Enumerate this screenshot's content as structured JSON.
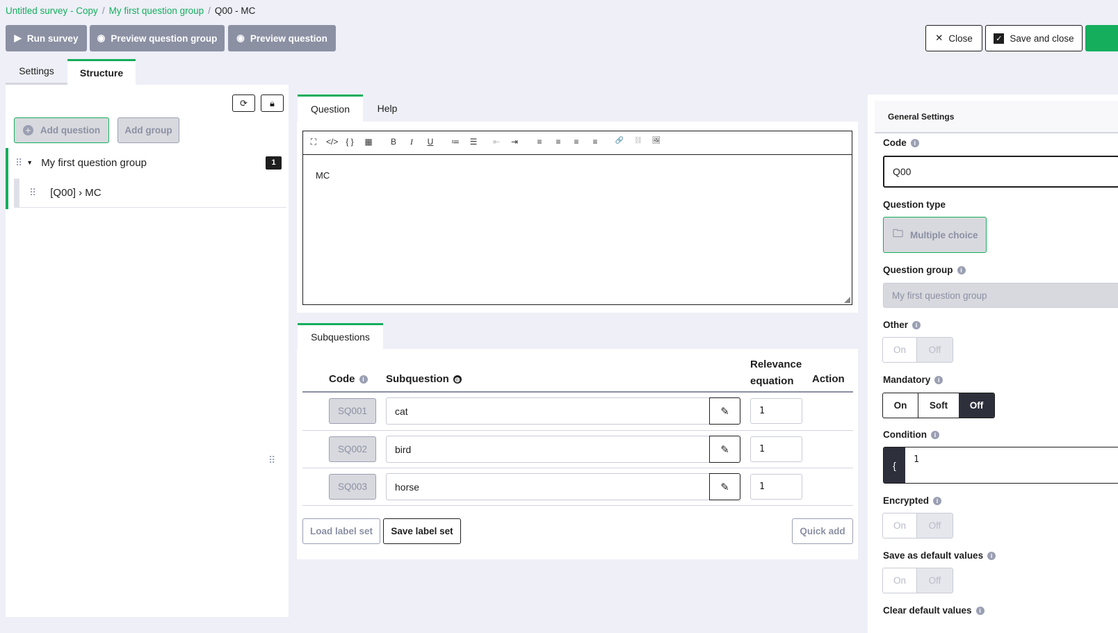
{
  "breadcrumb": {
    "survey": "Untitled survey - Copy",
    "group": "My first question group",
    "current": "Q00 - MC",
    "sep": "/"
  },
  "toolbar": {
    "run": "Run survey",
    "preview_group": "Preview question group",
    "preview_question": "Preview question",
    "close": "Close",
    "save_close": "Save and close"
  },
  "left_tabs": {
    "settings": "Settings",
    "structure": "Structure"
  },
  "structure": {
    "add_question": "Add question",
    "add_group": "Add group",
    "group_name": "My first question group",
    "group_count": "1",
    "question": "[Q00] › MC"
  },
  "editor": {
    "tab_question": "Question",
    "tab_help": "Help",
    "content": "MC",
    "tools": [
      "⛶",
      "</>",
      "{ }",
      "▦",
      "B",
      "I",
      "U",
      "≔",
      "☰",
      "⇤",
      "⇥",
      "≡",
      "≡",
      "≡",
      "≡",
      "🔗",
      "⛓",
      "🖼"
    ]
  },
  "subquestions": {
    "tab": "Subquestions",
    "col_code": "Code",
    "col_sub": "Subquestion",
    "col_rel": "Relevance equation",
    "col_action": "Action",
    "rows": [
      {
        "code": "SQ001",
        "text": "cat",
        "rel": "1"
      },
      {
        "code": "SQ002",
        "text": "bird",
        "rel": "1"
      },
      {
        "code": "SQ003",
        "text": "horse",
        "rel": "1"
      }
    ],
    "load": "Load label set",
    "save": "Save label set",
    "quick_add": "Quick add"
  },
  "settings": {
    "header": "General Settings",
    "code_label": "Code",
    "code_value": "Q00",
    "type_label": "Question type",
    "type_value": "Multiple choice",
    "group_label": "Question group",
    "group_value": "My first question group",
    "other_label": "Other",
    "mandatory_label": "Mandatory",
    "condition_label": "Condition",
    "condition_value": "1",
    "condition_brace": "{",
    "encrypted_label": "Encrypted",
    "save_default_label": "Save as default values",
    "clear_default_label": "Clear default values",
    "on": "On",
    "off": "Off",
    "soft": "Soft"
  },
  "colors": {
    "accent": "#14ae5c",
    "gray_button": "#8b90a3",
    "dark": "#2d2f3b"
  }
}
